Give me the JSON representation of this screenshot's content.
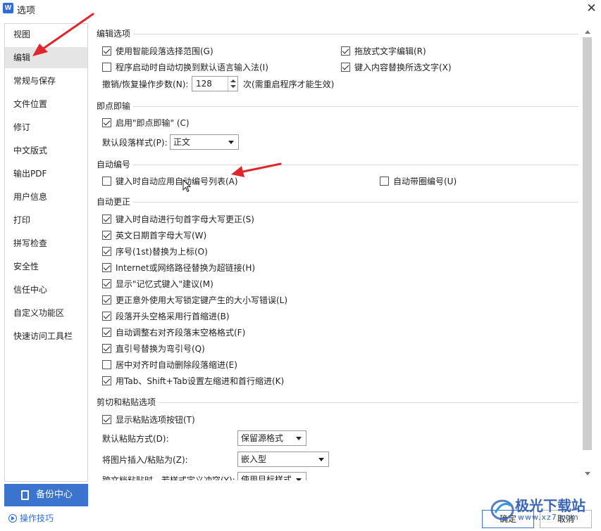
{
  "window": {
    "title": "选项",
    "app_icon_glyph": "W"
  },
  "sidebar": {
    "items": [
      {
        "label": "视图",
        "active": false
      },
      {
        "label": "编辑",
        "active": true
      },
      {
        "label": "常规与保存",
        "active": false
      },
      {
        "label": "文件位置",
        "active": false
      },
      {
        "label": "修订",
        "active": false
      },
      {
        "label": "中文版式",
        "active": false
      },
      {
        "label": "输出PDF",
        "active": false
      },
      {
        "label": "用户信息",
        "active": false
      },
      {
        "label": "打印",
        "active": false
      },
      {
        "label": "拼写检查",
        "active": false
      },
      {
        "label": "安全性",
        "active": false
      },
      {
        "label": "信任中心",
        "active": false
      },
      {
        "label": "自定义功能区",
        "active": false
      },
      {
        "label": "快速访问工具栏",
        "active": false
      }
    ],
    "backup_label": "备份中心",
    "tips_label": "操作技巧"
  },
  "sections": {
    "edit_options": {
      "header": "编辑选项",
      "smart_paragraph": {
        "label": "使用智能段落选择范围(G)",
        "checked": true
      },
      "drag_drop": {
        "label": "拖放式文字编辑(R)",
        "checked": true
      },
      "auto_ime": {
        "label": "程序启动时自动切换到默认语言输入法(I)",
        "checked": false
      },
      "typing_replace": {
        "label": "键入内容替换所选文字(X)",
        "checked": true
      },
      "undo_label": "撤销/恢复操作步数(N):",
      "undo_value": "128",
      "undo_note": "次(需重启程序才能生效)"
    },
    "click_type": {
      "header": "即点即输",
      "enable": {
        "label": "启用\"即点即输\" (C)",
        "checked": true
      },
      "default_style_label": "默认段落样式(P):",
      "default_style_value": "正文"
    },
    "auto_numbering": {
      "header": "自动编号",
      "apply_list": {
        "label": "键入时自动应用自动编号列表(A)",
        "checked": false
      },
      "circle_number": {
        "label": "自动带圈编号(U)",
        "checked": false
      }
    },
    "auto_correct": {
      "header": "自动更正",
      "items": [
        {
          "label": "键入时自动进行句首字母大写更正(S)",
          "checked": true
        },
        {
          "label": "英文日期首字母大写(W)",
          "checked": true
        },
        {
          "label": "序号(1st)替换为上标(O)",
          "checked": true
        },
        {
          "label": "Internet或网络路径替换为超链接(H)",
          "checked": true
        },
        {
          "label": "显示\"记忆式键入\"建议(M)",
          "checked": true
        },
        {
          "label": "更正意外使用大写锁定键产生的大小写错误(L)",
          "checked": true
        },
        {
          "label": "段落开头空格采用行首缩进(B)",
          "checked": true
        },
        {
          "label": "自动调整右对齐段落末空格格式(F)",
          "checked": true
        },
        {
          "label": "直引号替换为弯引号(Q)",
          "checked": true
        },
        {
          "label": "居中对齐时自动删除段落缩进(E)",
          "checked": false
        },
        {
          "label": "用Tab、Shift+Tab设置左缩进和首行缩进(K)",
          "checked": true
        }
      ]
    },
    "cut_paste": {
      "header": "剪切和粘贴选项",
      "show_paste_button": {
        "label": "显示粘贴选项按钮(T)",
        "checked": true
      },
      "default_paste_label": "默认粘贴方式(D):",
      "default_paste_value": "保留源格式",
      "insert_picture_label": "将图片插入/粘贴为(Z):",
      "insert_picture_value": "嵌入型",
      "cross_doc_label": "跨文档粘贴时，若样式定义冲突(Y):",
      "cross_doc_value": "使用目标样式"
    }
  },
  "buttons": {
    "ok": "确定",
    "cancel": "取消"
  },
  "watermark": {
    "title": "极光下载站",
    "url": "www.xz7.com"
  },
  "colors": {
    "accent": "#3a74cf",
    "annotation_arrow": "#e0262b"
  },
  "icons": {
    "close": "close-icon",
    "backup": "backup-icon",
    "tips": "play-circle-icon"
  }
}
